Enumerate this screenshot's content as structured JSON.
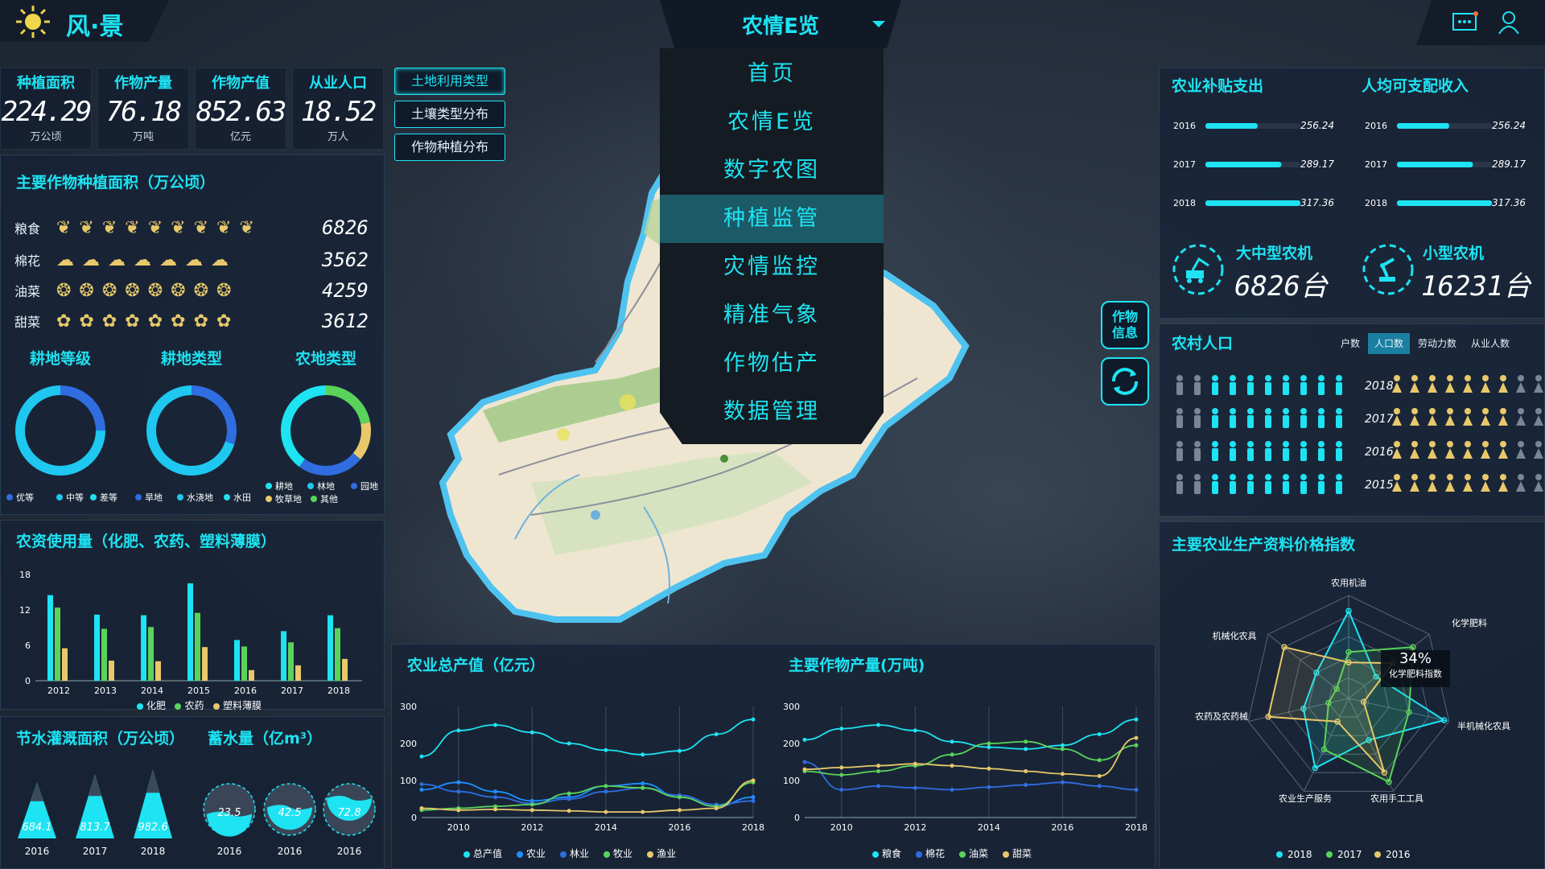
{
  "header": {
    "logo_text": "风·景",
    "title": "农情E览"
  },
  "stats": [
    {
      "label": "种植面积",
      "value": "224.29",
      "unit": "万公顷"
    },
    {
      "label": "作物产量",
      "value": "76.18",
      "unit": "万吨"
    },
    {
      "label": "作物产值",
      "value": "852.63",
      "unit": "亿元"
    },
    {
      "label": "从业人口",
      "value": "18.52",
      "unit": "万人"
    }
  ],
  "land_buttons": [
    "土地利用类型",
    "土壤类型分布",
    "作物种植分布"
  ],
  "menu": [
    "首页",
    "农情E览",
    "数字农图",
    "种植监管",
    "灾情监控",
    "精准气象",
    "作物估产",
    "数据管理"
  ],
  "side_buttons": {
    "crop_info": "作物信息"
  },
  "crops": {
    "title": "主要作物种植面积（万公顷）",
    "rows": [
      {
        "name": "粮食",
        "value": "6826",
        "icon": "wheat",
        "count": 9
      },
      {
        "name": "棉花",
        "value": "3562",
        "icon": "cotton",
        "count": 7
      },
      {
        "name": "油菜",
        "value": "4259",
        "icon": "rapeseed",
        "count": 8
      },
      {
        "name": "甜菜",
        "value": "3612",
        "icon": "beet",
        "count": 8
      }
    ]
  },
  "donuts": [
    {
      "title": "耕地等级",
      "legend": [
        "优等",
        "中等",
        "差等"
      ],
      "colors": [
        "#2f6de1",
        "#1ec8f0",
        "#22e0f0"
      ]
    },
    {
      "title": "耕地类型",
      "legend": [
        "旱地",
        "水浇地",
        "水田"
      ],
      "colors": [
        "#2f6de1",
        "#1ec8f0",
        "#22e0f0"
      ]
    },
    {
      "title": "农地类型",
      "legend": [
        "耕地",
        "林地",
        "园地",
        "牧草地",
        "其他"
      ],
      "colors": [
        "#22e0f0",
        "#1ec8f0",
        "#2f6de1",
        "#e8c86a",
        "#5ad35a"
      ]
    }
  ],
  "fert": {
    "title": "农资使用量（化肥、农药、塑料薄膜）",
    "legend": [
      "化肥",
      "农药",
      "塑料薄膜"
    ]
  },
  "water": {
    "title1": "节水灌溉面积（万公顷）",
    "title2": "蓄水量（亿m³）",
    "tri": [
      {
        "v": "684.1",
        "y": "2016"
      },
      {
        "v": "813.7",
        "y": "2017"
      },
      {
        "v": "982.6",
        "y": "2018"
      }
    ],
    "circ": [
      {
        "v": "23.5",
        "y": "2016"
      },
      {
        "v": "42.5",
        "y": "2016"
      },
      {
        "v": "72.8",
        "y": "2016"
      }
    ]
  },
  "subsidy": {
    "title1": "农业补贴支出",
    "title2": "人均可支配收入",
    "rows1": [
      {
        "year": "2016",
        "value": "256.24"
      },
      {
        "year": "2017",
        "value": "289.17"
      },
      {
        "year": "2018",
        "value": "317.36"
      }
    ],
    "rows2": [
      {
        "year": "2016",
        "value": "256.24"
      },
      {
        "year": "2017",
        "value": "289.17"
      },
      {
        "year": "2018",
        "value": "317.36"
      }
    ]
  },
  "machines": [
    {
      "label": "大中型农机",
      "value": "6826台"
    },
    {
      "label": "小型农机",
      "value": "16231台"
    }
  ],
  "rural": {
    "title": "农村人口",
    "tabs": [
      "户数",
      "人口数",
      "劳动力数",
      "从业人数"
    ],
    "years": [
      "2018",
      "2017",
      "2016",
      "2015"
    ]
  },
  "radar_title": "主要农业生产资料价格指数",
  "radar_tip": {
    "value": "34%",
    "label": "化学肥料指数"
  },
  "chart_data": [
    {
      "type": "bar",
      "title": "农资使用量（化肥、农药、塑料薄膜）",
      "categories": [
        "2012",
        "2013",
        "2014",
        "2015",
        "2016",
        "2017",
        "2018"
      ],
      "ylim": [
        0,
        18
      ],
      "yticks": [
        0,
        6,
        12,
        18
      ],
      "series": [
        {
          "name": "化肥",
          "color": "#1ee3f2",
          "values": [
            14.5,
            11.2,
            11.1,
            16.5,
            6.9,
            8.4,
            11.1
          ]
        },
        {
          "name": "农药",
          "color": "#5ad35a",
          "values": [
            12.4,
            8.8,
            9.1,
            11.5,
            5.8,
            6.5,
            8.9
          ]
        },
        {
          "name": "塑料薄膜",
          "color": "#e8c86a",
          "values": [
            5.5,
            3.4,
            3.3,
            5.7,
            1.8,
            2.6,
            3.7
          ]
        }
      ]
    },
    {
      "type": "line",
      "title": "农业总产值（亿元）",
      "x": [
        2009,
        2010,
        2011,
        2012,
        2013,
        2014,
        2015,
        2016,
        2017,
        2018
      ],
      "xticks": [
        2010,
        2012,
        2014,
        2016,
        2018
      ],
      "ylim": [
        0,
        300
      ],
      "yticks": [
        0,
        100,
        200,
        300
      ],
      "series": [
        {
          "name": "总产值",
          "color": "#1ee3f2",
          "values": [
            165,
            235,
            250,
            230,
            200,
            182,
            170,
            180,
            225,
            265
          ]
        },
        {
          "name": "农业",
          "color": "#1e90ff",
          "values": [
            75,
            95,
            70,
            45,
            55,
            85,
            92,
            55,
            30,
            55
          ]
        },
        {
          "name": "林业",
          "color": "#2f6de1",
          "values": [
            90,
            70,
            55,
            38,
            50,
            70,
            80,
            60,
            35,
            45
          ]
        },
        {
          "name": "牧业",
          "color": "#5ad35a",
          "values": [
            20,
            25,
            30,
            35,
            65,
            85,
            80,
            55,
            30,
            95
          ]
        },
        {
          "name": "渔业",
          "color": "#e8c86a",
          "values": [
            25,
            20,
            22,
            20,
            18,
            15,
            15,
            20,
            25,
            100
          ]
        }
      ]
    },
    {
      "type": "line",
      "title": "主要作物产量(万吨)",
      "x": [
        2009,
        2010,
        2011,
        2012,
        2013,
        2014,
        2015,
        2016,
        2017,
        2018
      ],
      "xticks": [
        2010,
        2012,
        2014,
        2016,
        2018
      ],
      "ylim": [
        0,
        300
      ],
      "yticks": [
        0,
        100,
        200,
        300
      ],
      "series": [
        {
          "name": "粮食",
          "color": "#1ee3f2",
          "values": [
            210,
            240,
            250,
            235,
            205,
            190,
            185,
            195,
            225,
            265
          ]
        },
        {
          "name": "棉花",
          "color": "#2f6de1",
          "values": [
            150,
            75,
            85,
            80,
            75,
            82,
            88,
            95,
            85,
            75
          ]
        },
        {
          "name": "油菜",
          "color": "#5ad35a",
          "values": [
            125,
            115,
            125,
            140,
            170,
            200,
            205,
            185,
            155,
            195
          ]
        },
        {
          "name": "甜菜",
          "color": "#e8c86a",
          "values": [
            130,
            135,
            140,
            145,
            140,
            132,
            125,
            118,
            112,
            215
          ]
        }
      ]
    },
    {
      "type": "radar",
      "title": "主要农业生产资料价格指数",
      "axes": [
        "农用机油",
        "化学肥料",
        "半机械化农具",
        "农用手工工具",
        "农业生产服务",
        "农药及农药械",
        "机械化农具"
      ],
      "series": [
        {
          "name": "2018",
          "color": "#1ee3f2",
          "values": [
            0.85,
            0.34,
            0.95,
            0.45,
            0.75,
            0.45,
            0.4
          ]
        },
        {
          "name": "2017",
          "color": "#5ad35a",
          "values": [
            0.45,
            0.8,
            0.6,
            0.9,
            0.55,
            0.2,
            0.15
          ]
        },
        {
          "name": "2016",
          "color": "#e8c86a",
          "values": [
            0.35,
            0.55,
            0.15,
            0.8,
            0.25,
            0.8,
            0.8
          ]
        }
      ]
    }
  ]
}
